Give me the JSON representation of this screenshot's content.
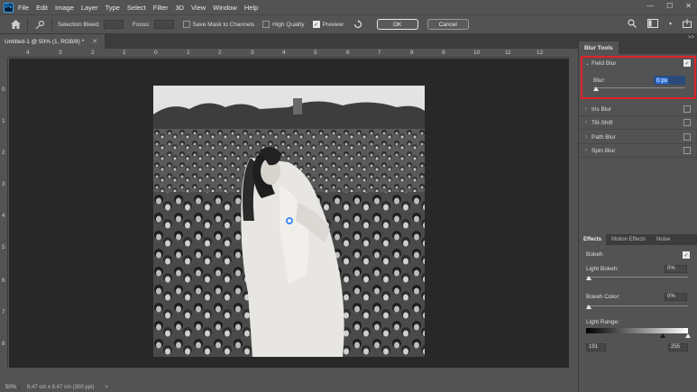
{
  "menubar": {
    "logo": "Ps",
    "items": [
      "File",
      "Edit",
      "Image",
      "Layer",
      "Type",
      "Select",
      "Filter",
      "3D",
      "View",
      "Window",
      "Help"
    ],
    "win_controls": [
      "—",
      "☐",
      "✕"
    ]
  },
  "options": {
    "selection_bleed_label": "Selection Bleed:",
    "focus_label": "Focus:",
    "save_mask_label": "Save Mask to Channels",
    "high_quality_label": "High Quality",
    "preview_label": "Preview",
    "preview_checked": true,
    "ok_label": "OK",
    "cancel_label": "Cancel"
  },
  "document": {
    "tab_title": "Untitled-1 @ 50% (1, RGB/8) *",
    "ruler_top": [
      "4",
      "3",
      "2",
      "1",
      "0",
      "1",
      "2",
      "3",
      "4",
      "5",
      "6",
      "7",
      "8",
      "9",
      "10",
      "11",
      "12"
    ],
    "ruler_left": [
      "0",
      "1",
      "2",
      "3",
      "4",
      "5",
      "6",
      "7",
      "8"
    ]
  },
  "status": {
    "zoom": "50%",
    "doc_info": "8.47 cm x 8.47 cm (300 ppi)",
    "arrow": ">"
  },
  "panels": {
    "collapse": ">>",
    "blur_tools_tab": "Blur Tools",
    "blur_items": [
      {
        "label": "Field Blur",
        "checked": true,
        "expanded": true
      },
      {
        "label": "Iris Blur",
        "checked": false
      },
      {
        "label": "Tilt-Shift",
        "checked": false
      },
      {
        "label": "Path Blur",
        "checked": false
      },
      {
        "label": "Spin Blur",
        "checked": false
      }
    ],
    "blur_label": "Blur:",
    "blur_value": "0 px",
    "effects_tabs": [
      "Effects",
      "Motion Effects",
      "Noise"
    ],
    "bokeh_label": "Bokeh",
    "bokeh_checked": true,
    "light_bokeh_label": "Light Bokeh:",
    "light_bokeh_value": "0%",
    "bokeh_color_label": "Bokeh Color:",
    "bokeh_color_value": "0%",
    "light_range_label": "Light Range:",
    "light_range_low": "191",
    "light_range_high": "255"
  },
  "colors": {
    "accent_blue": "#3d8bfd",
    "highlight_red": "#e0222a"
  }
}
